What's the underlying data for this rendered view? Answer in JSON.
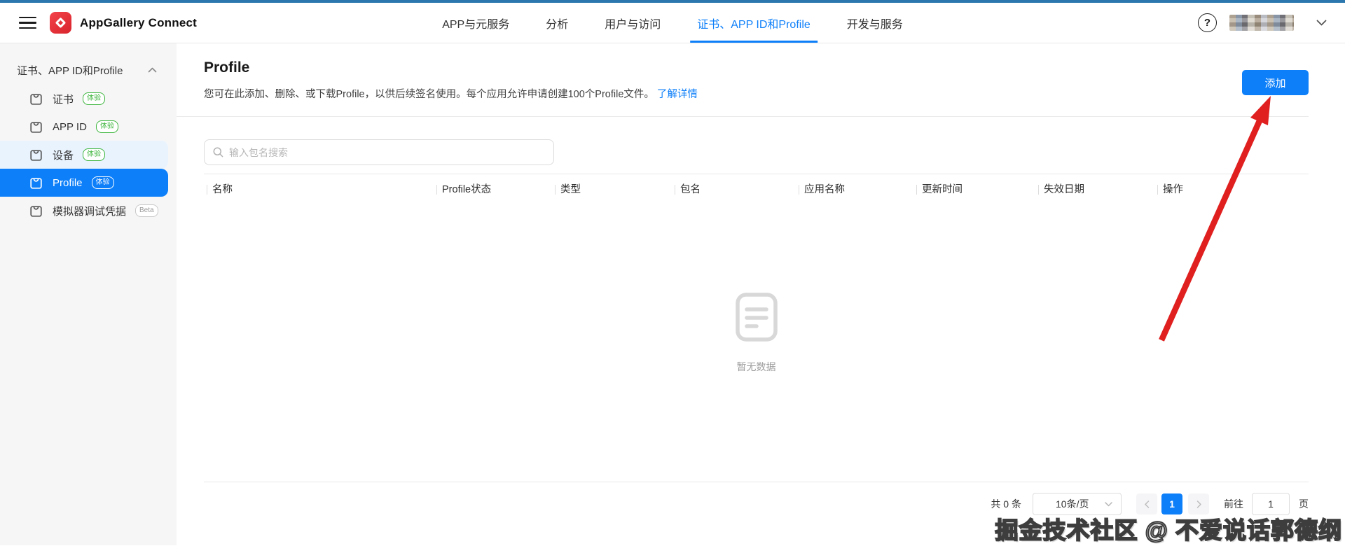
{
  "brand": {
    "name": "AppGallery Connect"
  },
  "topnav": {
    "items": [
      {
        "label": "APP与元服务"
      },
      {
        "label": "分析"
      },
      {
        "label": "用户与访问"
      },
      {
        "label": "证书、APP ID和Profile"
      },
      {
        "label": "开发与服务"
      }
    ],
    "help_icon": "?"
  },
  "sidebar": {
    "group_title": "证书、APP ID和Profile",
    "items": [
      {
        "label": "证书",
        "badge": "体验"
      },
      {
        "label": "APP ID",
        "badge": "体验"
      },
      {
        "label": "设备",
        "badge": "体验"
      },
      {
        "label": "Profile",
        "badge": "体验"
      },
      {
        "label": "模拟器调试凭据",
        "badge": "Beta"
      }
    ]
  },
  "page": {
    "title": "Profile",
    "description": "您可在此添加、删除、或下载Profile，以供后续签名使用。每个应用允许申请创建100个Profile文件。",
    "learn_more": "了解详情",
    "add_button": "添加"
  },
  "search": {
    "placeholder": "输入包名搜索"
  },
  "table": {
    "columns": [
      "名称",
      "Profile状态",
      "类型",
      "包名",
      "应用名称",
      "更新时间",
      "失效日期",
      "操作"
    ],
    "empty_text": "暂无数据"
  },
  "pagination": {
    "total_text": "共 0 条",
    "page_size": "10条/页",
    "current_page": "1",
    "goto_label": "前往",
    "goto_value": "1",
    "page_unit": "页"
  },
  "watermark": "掘金技术社区 @ 不爱说话郭德纲",
  "colors": {
    "primary": "#0d7ff9",
    "badge_green": "#3cb53c",
    "arrow_red": "#e01f1f",
    "topstrip": "#2b77ae"
  }
}
